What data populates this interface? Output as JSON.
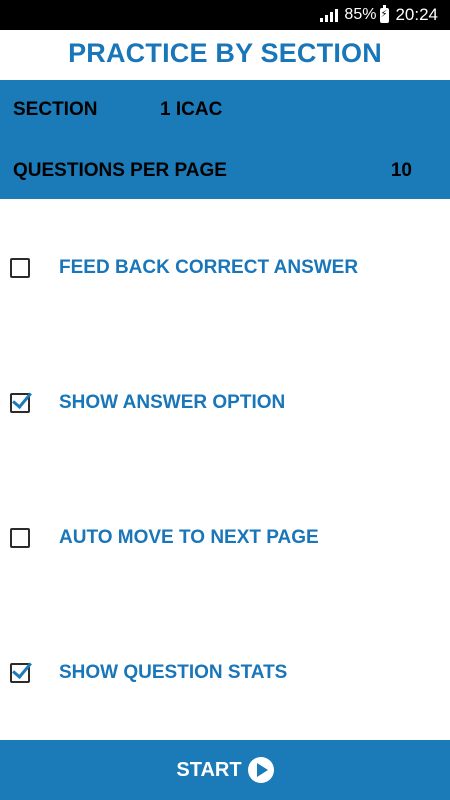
{
  "status_bar": {
    "battery": "85%",
    "time": "20:24",
    "icons": [
      "signal-icon",
      "battery-charging-icon"
    ]
  },
  "page_title": "PRACTICE BY SECTION",
  "settings": {
    "section_label": "SECTION",
    "section_value": "1 ICAC",
    "qpp_label": "QUESTIONS PER PAGE",
    "qpp_value": "10"
  },
  "options": [
    {
      "label": "FEED BACK CORRECT ANSWER",
      "checked": false
    },
    {
      "label": "SHOW ANSWER OPTION",
      "checked": true
    },
    {
      "label": "AUTO MOVE TO NEXT PAGE",
      "checked": false
    },
    {
      "label": "SHOW QUESTION STATS",
      "checked": true
    }
  ],
  "start": {
    "label": "START",
    "icon": "play-circle-icon"
  },
  "colors": {
    "accent": "#1b7ab8",
    "title": "#1976b8",
    "status_bar": "#000000"
  }
}
